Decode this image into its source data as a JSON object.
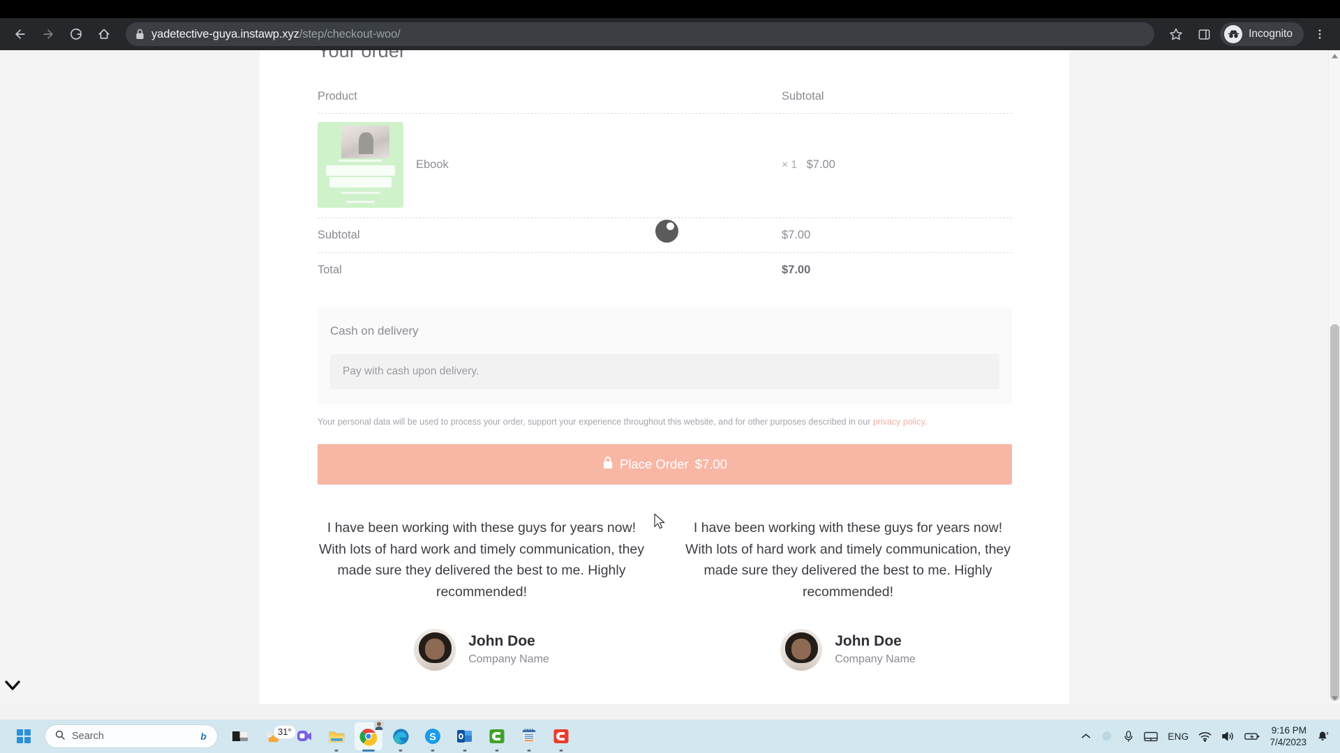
{
  "browser": {
    "back_label": "Back",
    "forward_label": "Forward",
    "reload_label": "Reload",
    "home_label": "Home",
    "url_domain": "yadetective-guya.instawp.xyz",
    "url_path": "/step/checkout-woo/",
    "lock_icon": "site-security-lock-icon",
    "bookmark_label": "Bookmark this tab",
    "side_panel_label": "Side panel",
    "profile_label": "Incognito",
    "menu_label": "Customize and control Google Chrome"
  },
  "page": {
    "section_title": "Your order",
    "order": {
      "columns": [
        "Product",
        "Subtotal"
      ],
      "items": [
        {
          "name": "Ebook",
          "quantity": "× 1",
          "amount": "$7.00",
          "thumbnail_alt": "FINANCE BASICS ebook cover"
        }
      ],
      "totals": [
        {
          "label": "Subtotal",
          "amount": "$7.00",
          "bold": false
        },
        {
          "label": "Total",
          "amount": "$7.00",
          "bold": true
        }
      ]
    },
    "payment": {
      "method_label": "Cash on delivery",
      "method_description": "Pay with cash upon delivery.",
      "privacy_note_before": "Your personal data will be used to process your order, support your experience throughout this website, and for other purposes described in our ",
      "privacy_link": "privacy policy",
      "privacy_note_after": "."
    },
    "place_order": {
      "label": "Place Order",
      "amount": "$7.00",
      "icon": "lock-icon",
      "color": "#f8b6a4"
    },
    "testimonials": [
      {
        "quote": "I have been working with these guys for years now! With lots of hard work and timely communication, they made sure they delivered the best to me. Highly recommended!",
        "name": "John Doe",
        "company": "Company Name"
      },
      {
        "quote": "I have been working with these guys for years now! With lots of hard work and timely communication, they made sure they delivered the best to me. Highly recommended!",
        "name": "John Doe",
        "company": "Company Name"
      }
    ],
    "loading_indicator": "blockui-spinner"
  },
  "taskbar": {
    "start_label": "Start",
    "search_placeholder": "Search",
    "weather_temperature": "31°",
    "apps": [
      {
        "name": "taskbar-app-widgets",
        "label": "Widgets"
      },
      {
        "name": "taskbar-app-weather",
        "label": "Weather"
      },
      {
        "name": "taskbar-app-chat",
        "label": "Chat"
      },
      {
        "name": "taskbar-app-file-explorer",
        "label": "File Explorer"
      },
      {
        "name": "taskbar-app-chrome",
        "label": "Google Chrome"
      },
      {
        "name": "taskbar-app-edge",
        "label": "Microsoft Edge"
      },
      {
        "name": "taskbar-app-skype",
        "label": "Skype"
      },
      {
        "name": "taskbar-app-outlook",
        "label": "Outlook"
      },
      {
        "name": "taskbar-app-camtasia",
        "label": "Camtasia"
      },
      {
        "name": "taskbar-app-notepad",
        "label": "Notepad"
      },
      {
        "name": "taskbar-app-camtasia-recorder",
        "label": "Camtasia Recorder"
      }
    ],
    "tray": {
      "overflow_label": "Show hidden icons",
      "language": "ENG",
      "time": "9:16 PM",
      "date": "7/4/2023",
      "notification_label": "Notifications"
    }
  }
}
